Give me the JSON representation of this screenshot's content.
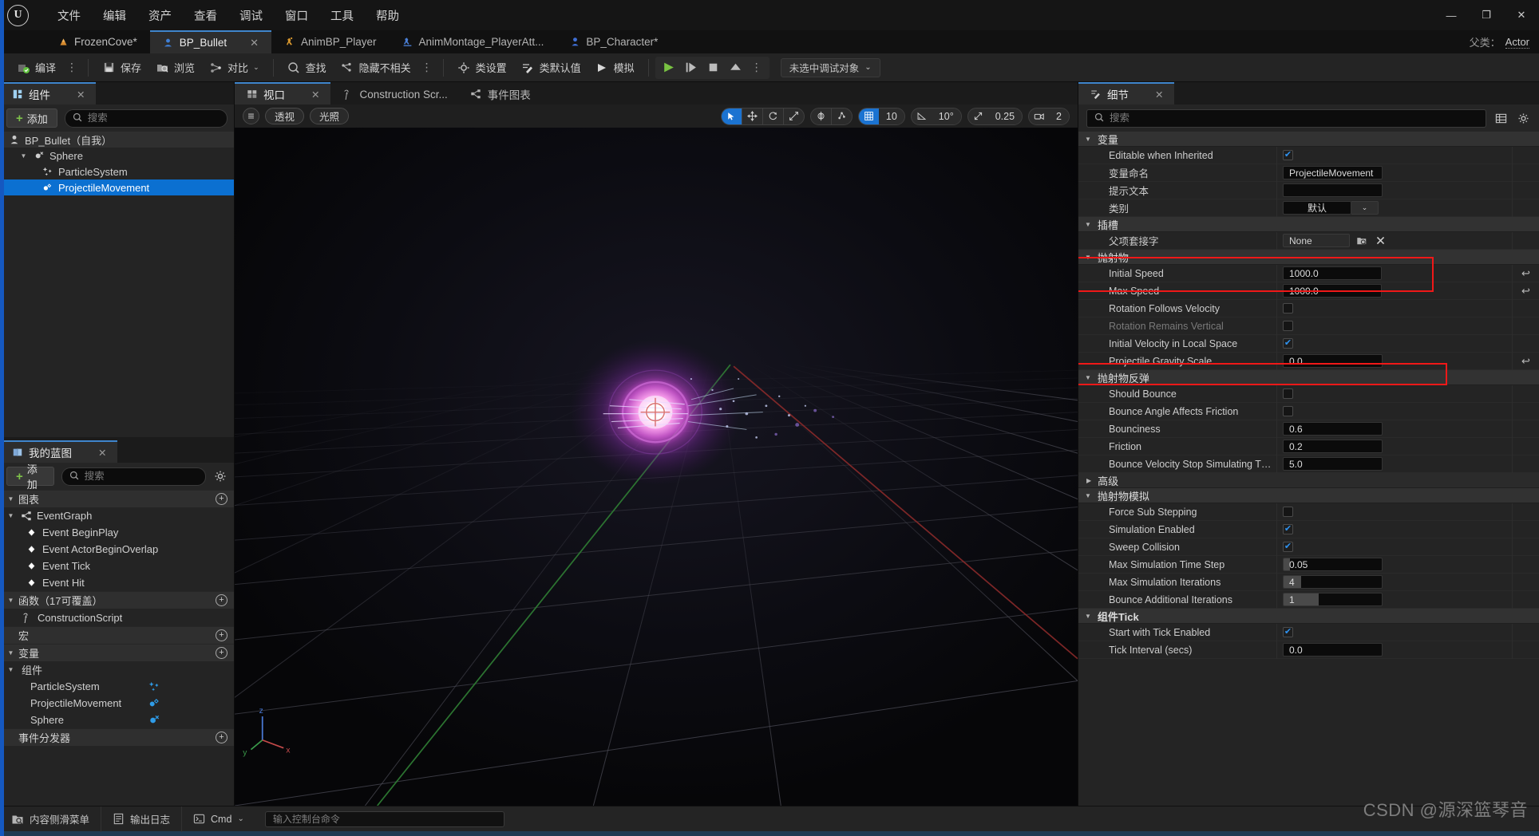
{
  "app": {
    "logo": "unreal-engine-logo",
    "menu": [
      "文件",
      "编辑",
      "资产",
      "查看",
      "调试",
      "窗口",
      "工具",
      "帮助"
    ],
    "window_controls": {
      "minimize": "—",
      "maximize": "❐",
      "close": "✕"
    }
  },
  "tabs": {
    "items": [
      {
        "label": "FrozenCove*",
        "icon": "project-icon",
        "active": false,
        "closable": false
      },
      {
        "label": "BP_Bullet",
        "icon": "blueprint-actor-icon",
        "active": true,
        "closable": true,
        "close": "✕"
      },
      {
        "label": "AnimBP_Player",
        "icon": "anim-blueprint-icon",
        "active": false,
        "closable": false
      },
      {
        "label": "AnimMontage_PlayerAtt...",
        "icon": "anim-montage-icon",
        "active": false,
        "closable": false
      },
      {
        "label": "BP_Character*",
        "icon": "blueprint-character-icon",
        "active": false,
        "closable": false
      }
    ],
    "parent_label": "父类：",
    "parent_value": "Actor"
  },
  "toolbar": {
    "compile": "编译",
    "save": "保存",
    "browse": "浏览",
    "diff": "对比",
    "find": "查找",
    "hide_unrelated": "隐藏不相关",
    "class_settings": "类设置",
    "class_defaults": "类默认值",
    "simulate": "模拟",
    "overflow": "⋮",
    "play_icons": [
      "play-icon",
      "step-icon",
      "stop-icon",
      "eject-icon"
    ],
    "debug_object": "未选中调试对象",
    "debug_caret": "⌄"
  },
  "components_panel": {
    "tab_title": "组件",
    "tab_icon": "components-icon",
    "close": "✕",
    "add_label": "添加",
    "search_placeholder": "搜索",
    "tree": [
      {
        "label": "BP_Bullet（自我）",
        "icon": "actor-icon",
        "indent": 0,
        "state": "self",
        "arrow": ""
      },
      {
        "label": "Sphere",
        "icon": "sphere-component-icon",
        "indent": 1,
        "state": "normal",
        "arrow": "▼"
      },
      {
        "label": "ParticleSystem",
        "icon": "particle-system-icon",
        "indent": 2,
        "state": "normal",
        "arrow": ""
      },
      {
        "label": "ProjectileMovement",
        "icon": "projectile-movement-icon",
        "indent": 2,
        "state": "selected",
        "arrow": ""
      }
    ]
  },
  "my_blueprint_panel": {
    "tab_title": "我的蓝图",
    "tab_icon": "my-blueprint-icon",
    "close": "✕",
    "add_label": "添加",
    "search_placeholder": "搜索",
    "gear_icon": "gear-icon",
    "sections": [
      {
        "type": "section",
        "label": "图表",
        "arrow": "▼",
        "plus": "+"
      },
      {
        "type": "item",
        "label": "EventGraph",
        "icon": "event-graph-icon",
        "indent": 1,
        "arrow": "▼"
      },
      {
        "type": "item",
        "label": "Event BeginPlay",
        "icon": "event-node-icon",
        "indent": 2,
        "arrow": ""
      },
      {
        "type": "item",
        "label": "Event ActorBeginOverlap",
        "icon": "event-node-icon",
        "indent": 2,
        "arrow": ""
      },
      {
        "type": "item",
        "label": "Event Tick",
        "icon": "event-node-icon",
        "indent": 2,
        "arrow": ""
      },
      {
        "type": "item",
        "label": "Event Hit",
        "icon": "event-node-icon",
        "indent": 2,
        "arrow": ""
      },
      {
        "type": "section",
        "label": "函数（17可覆盖）",
        "arrow": "▼",
        "plus": "+"
      },
      {
        "type": "item",
        "label": "ConstructionScript",
        "icon": "function-icon",
        "indent": 1,
        "arrow": ""
      },
      {
        "type": "section",
        "label": "宏",
        "arrow": "",
        "plus": "+"
      },
      {
        "type": "section",
        "label": "变量",
        "arrow": "▼",
        "plus": "+"
      },
      {
        "type": "item",
        "label": "组件",
        "icon": "",
        "indent": 0,
        "arrow": "▼"
      },
      {
        "type": "var",
        "label": "ParticleSystem",
        "icon": "particle-system-icon",
        "indent": 2
      },
      {
        "type": "var",
        "label": "ProjectileMovement",
        "icon": "projectile-movement-icon",
        "indent": 2
      },
      {
        "type": "var",
        "label": "Sphere",
        "icon": "sphere-component-icon",
        "indent": 2
      },
      {
        "type": "section",
        "label": "事件分发器",
        "arrow": "",
        "plus": "+"
      }
    ]
  },
  "viewport_panel": {
    "tabs": [
      {
        "label": "视口",
        "icon": "viewport-icon",
        "active": true,
        "close": "✕"
      },
      {
        "label": "Construction Scr...",
        "icon": "function-icon",
        "active": false
      },
      {
        "label": "事件图表",
        "icon": "event-graph-icon",
        "active": false
      }
    ],
    "menu_icon": "hamburger-icon",
    "view_mode": "透视",
    "lighting_mode": "光照",
    "gizmo": {
      "select_icon": "cursor-select-icon",
      "move_icon": "move-gizmo-icon",
      "rotate_icon": "rotate-gizmo-icon",
      "scale_icon": "scale-gizmo-icon",
      "world_icon": "world-space-icon",
      "surface_snap_icon": "surface-snap-icon",
      "grid_snap_icon": "grid-snap-icon",
      "grid_value": "10",
      "angle_snap_icon": "angle-snap-icon",
      "angle_value": "10°",
      "scale_snap_icon": "scale-snap-icon",
      "scale_value": "0.25",
      "camera_icon": "camera-speed-icon",
      "camera_value": "2"
    }
  },
  "details_panel": {
    "tab_title": "细节",
    "tab_icon": "details-icon",
    "close": "✕",
    "search_placeholder": "搜索",
    "column_icon": "column-layout-icon",
    "settings_icon": "gear-icon",
    "groups": [
      {
        "title": "变量",
        "expanded": true,
        "rows": [
          {
            "label": "Editable when Inherited",
            "type": "checkbox",
            "value": true,
            "reset": false
          },
          {
            "label": "变量命名",
            "type": "text",
            "value": "ProjectileMovement",
            "reset": false
          },
          {
            "label": "提示文本",
            "type": "text",
            "value": "",
            "reset": false
          },
          {
            "label": "类别",
            "type": "combo",
            "value": "默认",
            "reset": false
          }
        ]
      },
      {
        "title": "插槽",
        "expanded": true,
        "rows": [
          {
            "label": "父项套接字",
            "type": "asset",
            "value": "None",
            "reset": false
          }
        ]
      },
      {
        "title": "抛射物",
        "expanded": true,
        "rows": [
          {
            "label": "Initial Speed",
            "type": "number",
            "value": "1000.0",
            "reset": true,
            "highlight": "a"
          },
          {
            "label": "Max Speed",
            "type": "number",
            "value": "1000.0",
            "reset": true,
            "highlight": "a"
          },
          {
            "label": "Rotation Follows Velocity",
            "type": "checkbox",
            "value": false,
            "reset": false
          },
          {
            "label": "Rotation Remains Vertical",
            "type": "checkbox",
            "value": false,
            "reset": false,
            "disabled": true
          },
          {
            "label": "Initial Velocity in Local Space",
            "type": "checkbox",
            "value": true,
            "reset": false
          },
          {
            "label": "Projectile Gravity Scale",
            "type": "number",
            "value": "0.0",
            "reset": true,
            "highlight": "b"
          }
        ]
      },
      {
        "title": "抛射物反弹",
        "expanded": true,
        "rows": [
          {
            "label": "Should Bounce",
            "type": "checkbox",
            "value": false,
            "reset": false
          },
          {
            "label": "Bounce Angle Affects Friction",
            "type": "checkbox",
            "value": false,
            "reset": false
          },
          {
            "label": "Bounciness",
            "type": "number",
            "value": "0.6",
            "reset": false
          },
          {
            "label": "Friction",
            "type": "number",
            "value": "0.2",
            "reset": false
          },
          {
            "label": "Bounce Velocity Stop Simulating Threshold",
            "type": "number",
            "value": "5.0",
            "reset": false
          }
        ]
      },
      {
        "title": "高级",
        "expanded": false,
        "rows": []
      },
      {
        "title": "抛射物模拟",
        "expanded": true,
        "rows": [
          {
            "label": "Force Sub Stepping",
            "type": "checkbox",
            "value": false,
            "reset": false
          },
          {
            "label": "Simulation Enabled",
            "type": "checkbox",
            "value": true,
            "reset": false
          },
          {
            "label": "Sweep Collision",
            "type": "checkbox",
            "value": true,
            "reset": false
          },
          {
            "label": "Max Simulation Time Step",
            "type": "slider",
            "value": "0.05",
            "fill": 1,
            "reset": false
          },
          {
            "label": "Max Simulation Iterations",
            "type": "slider",
            "value": "4",
            "fill": 2,
            "reset": false
          },
          {
            "label": "Bounce Additional Iterations",
            "type": "slider",
            "value": "1",
            "fill": 3,
            "reset": false
          }
        ]
      },
      {
        "title": "组件Tick",
        "expanded": true,
        "rows": [
          {
            "label": "Start with Tick Enabled",
            "type": "checkbox",
            "value": true,
            "reset": false
          },
          {
            "label": "Tick Interval (secs)",
            "type": "number",
            "value": "0.0",
            "reset": false
          }
        ]
      }
    ]
  },
  "statusbar": {
    "content_drawer": "内容侧滑菜单",
    "content_drawer_icon": "drawer-icon",
    "output_log": "输出日志",
    "output_log_icon": "log-icon",
    "cmd_label": "Cmd",
    "cmd_icon": "terminal-icon",
    "cmd_caret": "⌄",
    "cmd_placeholder": "输入控制台命令"
  },
  "watermark": {
    "text": "CSDN @源深篮琴音"
  },
  "colors": {
    "accent_blue": "#0b70d1",
    "highlight_red": "#f01818",
    "green": "#7ec24a",
    "panel_bg": "#242424",
    "dark_bg": "#1b1b1b"
  }
}
